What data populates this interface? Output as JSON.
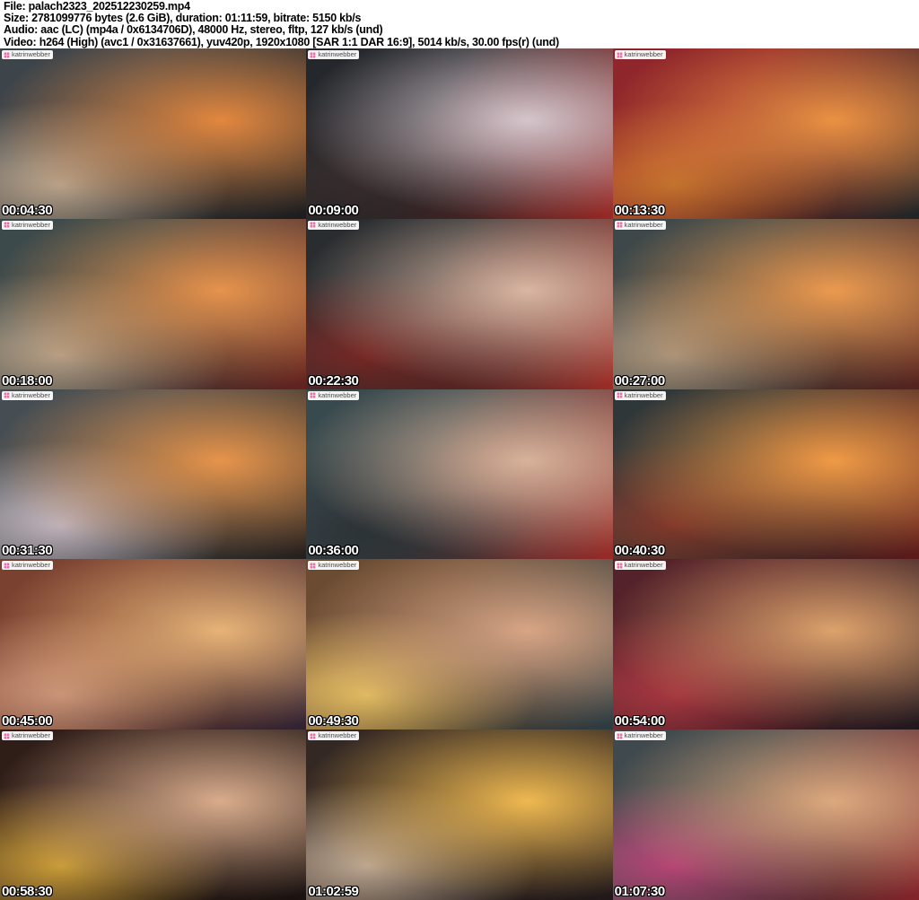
{
  "colors": {
    "page_bg": "#ffffff",
    "header_bg": "#ffffff",
    "header_text": "#000000",
    "timestamp_text": "#ffffff",
    "watermark_bg": "rgba(255,255,255,0.94)",
    "watermark_text": "#4a4a4a",
    "watermark_icon": "#ee6fa7"
  },
  "file_info": {
    "file": "File: palach2323_202512230259.mp4",
    "size": "Size: 2781099776 bytes (2.6 GiB), duration: 01:11:59, bitrate: 5150 kb/s",
    "audio": "Audio: aac (LC) (mp4a / 0x6134706D), 48000 Hz, stereo, fltp, 127 kb/s (und)",
    "video": "Video: h264 (High) (avc1 / 0x31637661), yuv420p, 1920x1080 [SAR 1:1 DAR 16:9], 5014 kb/s, 30.00 fps(r) (und)"
  },
  "watermark": {
    "text": "katrinwebber"
  },
  "grid": {
    "columns": 3,
    "rows": 5
  },
  "thumbnails": [
    {
      "timestamp": "00:04:30",
      "palette": [
        "#3d444a",
        "#e2873f",
        "#c5ad92",
        "#1f1e20"
      ]
    },
    {
      "timestamp": "00:09:00",
      "palette": [
        "#24272b",
        "#d5c6cc",
        "#3a2e2e",
        "#a52c28"
      ]
    },
    {
      "timestamp": "00:13:30",
      "palette": [
        "#8f262b",
        "#ea9143",
        "#d07a30",
        "#22282a"
      ]
    },
    {
      "timestamp": "00:18:00",
      "palette": [
        "#3d4a4b",
        "#e6934c",
        "#c4aa8e",
        "#6b2420"
      ]
    },
    {
      "timestamp": "00:22:30",
      "palette": [
        "#292d30",
        "#d8b6a2",
        "#7e2a26",
        "#a93129"
      ]
    },
    {
      "timestamp": "00:27:00",
      "palette": [
        "#3e484a",
        "#eb9a4f",
        "#b89e82",
        "#5c2521"
      ]
    },
    {
      "timestamp": "00:31:30",
      "palette": [
        "#474e53",
        "#e6944b",
        "#cdbfc7",
        "#29221f"
      ]
    },
    {
      "timestamp": "00:36:00",
      "palette": [
        "#394a4e",
        "#d8b299",
        "#30363a",
        "#a52e2a"
      ]
    },
    {
      "timestamp": "00:40:30",
      "palette": [
        "#303739",
        "#f09a45",
        "#8a3c2c",
        "#641c1c"
      ]
    },
    {
      "timestamp": "00:45:00",
      "palette": [
        "#7a4130",
        "#e7b377",
        "#d69e80",
        "#342536"
      ]
    },
    {
      "timestamp": "00:49:30",
      "palette": [
        "#6b4c33",
        "#d8a585",
        "#f0c868",
        "#2f4046"
      ]
    },
    {
      "timestamp": "00:54:00",
      "palette": [
        "#54222a",
        "#dda26c",
        "#b03a44",
        "#241a20"
      ]
    },
    {
      "timestamp": "00:58:30",
      "palette": [
        "#2f1d18",
        "#d9ac8c",
        "#d7a73c",
        "#1d1412"
      ]
    },
    {
      "timestamp": "01:02:59",
      "palette": [
        "#342824",
        "#efb950",
        "#c9b29b",
        "#231a1c"
      ]
    },
    {
      "timestamp": "01:07:30",
      "palette": [
        "#40494d",
        "#dca97e",
        "#c2497c",
        "#8e262c"
      ]
    }
  ]
}
